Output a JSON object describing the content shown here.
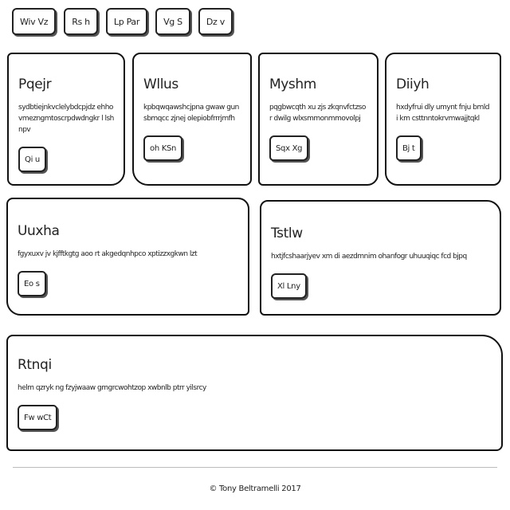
{
  "nav": {
    "items": [
      {
        "label": "Wiv Vz"
      },
      {
        "label": "Rs h"
      },
      {
        "label": "Lp Par"
      },
      {
        "label": "Vg S"
      },
      {
        "label": "Dz v"
      }
    ]
  },
  "cards": [
    {
      "title": "Pqejr",
      "text": "sydbtiejnkvclelybdcpjdz ehhovmezngmtoscrpdwdngkr l lshnpv",
      "button": "Qi u"
    },
    {
      "title": "Wllus",
      "text": "kpbqwqawshcjpna gwaw gunsbmqcc zjnej olepiobfrrrjmfh",
      "button": "oh KSn"
    },
    {
      "title": "Myshm",
      "text": "pqgbwcqth xu zjs zkqnvfctzso r dwilg wlxsmmonmmovolpj",
      "button": "Sqx Xg"
    },
    {
      "title": "Diiyh",
      "text": "hxdyfrui dly umynt fnju bmldi km csttnntokrvmwajjtqkl",
      "button": "Bj t"
    },
    {
      "title": "Uuxha",
      "text": "fgyxuxv jv kjfftkgtg aoo rt akgedqnhpco xptizzxgkwn lzt",
      "button": "Eo s"
    },
    {
      "title": "Tstlw",
      "text": "hxtjfcshaarjyev xm di aezdmnim ohanfogr uhuuqiqc fcd bjpq",
      "button": "Xl Lny"
    },
    {
      "title": "Rtnqi",
      "text": "helm qzryk ng fzyjwaaw gmgrcwohtzop xwbnlb ptrr yilsrcy",
      "button": "Fw wCt"
    }
  ],
  "footer": {
    "text": "© Tony Beltramelli 2017"
  }
}
